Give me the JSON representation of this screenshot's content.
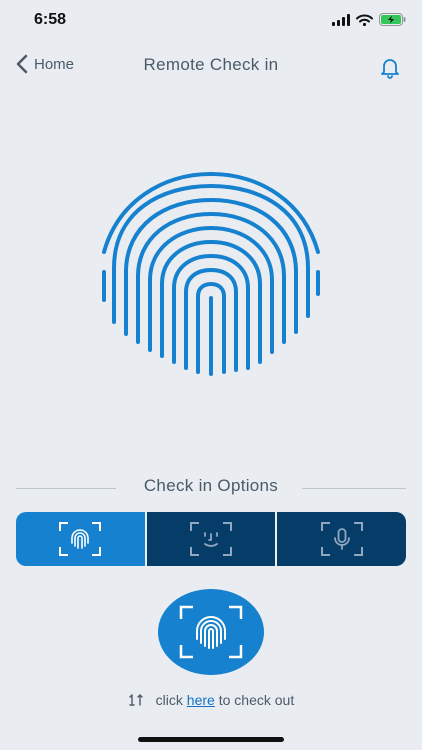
{
  "status_bar": {
    "time": "6:58",
    "icons": [
      "signal-icon",
      "wifi-icon",
      "battery-charging-icon"
    ]
  },
  "nav": {
    "back_label": "Home",
    "title": "Remote Check in",
    "right_icon": "bell-icon"
  },
  "hero": {
    "icon": "fingerprint-icon",
    "color": "#1681cf"
  },
  "options": {
    "title": "Check in Options",
    "items": [
      {
        "name": "fingerprint",
        "icon": "fingerprint-scan-icon",
        "selected": true
      },
      {
        "name": "face",
        "icon": "face-scan-icon",
        "selected": false
      },
      {
        "name": "voice",
        "icon": "voice-scan-icon",
        "selected": false
      }
    ]
  },
  "scan_button": {
    "icon": "fingerprint-scan-icon"
  },
  "checkout": {
    "icon": "swap-icon",
    "prefix": "click",
    "link": "here",
    "suffix": "to check out"
  },
  "colors": {
    "background": "#e9edf2",
    "accent": "#1681cf",
    "dark": "#053c68",
    "text": "#4a5a68",
    "link": "#1672c4"
  }
}
